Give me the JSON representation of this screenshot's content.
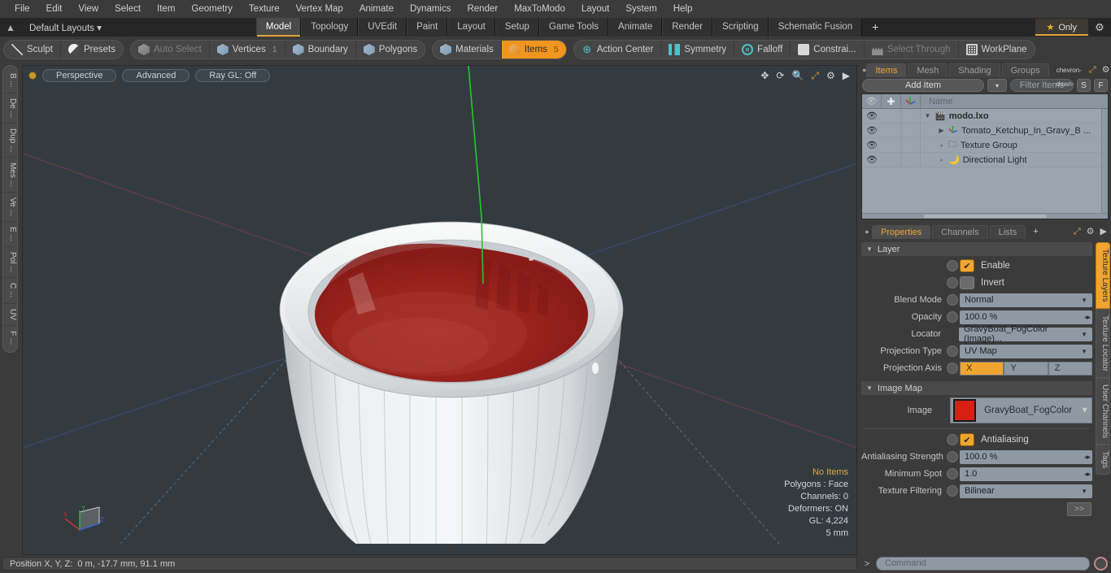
{
  "menu": {
    "items": [
      "File",
      "Edit",
      "View",
      "Select",
      "Item",
      "Geometry",
      "Texture",
      "Vertex Map",
      "Animate",
      "Dynamics",
      "Render",
      "MaxToModo",
      "Layout",
      "System",
      "Help"
    ]
  },
  "layout_row": {
    "home_icon": "home-icon",
    "default_layouts": "Default Layouts",
    "tabs": [
      {
        "label": "Model",
        "active": true
      },
      {
        "label": "Topology",
        "active": false
      },
      {
        "label": "UVEdit",
        "active": false
      },
      {
        "label": "Paint",
        "active": false
      },
      {
        "label": "Layout",
        "active": false
      },
      {
        "label": "Setup",
        "active": false
      },
      {
        "label": "Game Tools",
        "active": false
      },
      {
        "label": "Animate",
        "active": false
      },
      {
        "label": "Render",
        "active": false
      },
      {
        "label": "Scripting",
        "active": false
      },
      {
        "label": "Schematic Fusion",
        "active": false
      }
    ],
    "add_tab": "+",
    "only_label": "Only",
    "star_icon": "star-icon",
    "gear_icon": "gear-icon"
  },
  "toolbar": {
    "group1": [
      {
        "label": "Sculpt",
        "icon": "pen-icon",
        "state": "normal",
        "count": ""
      },
      {
        "label": "Presets",
        "icon": "sphere-icon",
        "state": "normal",
        "count": ""
      }
    ],
    "group2": [
      {
        "label": "Auto Select",
        "icon": "cube-grey-icon",
        "state": "dim",
        "count": ""
      },
      {
        "label": "Vertices",
        "icon": "cube-icon",
        "state": "normal",
        "count": "1"
      },
      {
        "label": "Boundary",
        "icon": "cube-icon",
        "state": "normal",
        "count": ""
      },
      {
        "label": "Polygons",
        "icon": "cube-icon",
        "state": "normal",
        "count": ""
      }
    ],
    "group3": [
      {
        "label": "Materials",
        "icon": "cube-icon",
        "state": "normal",
        "count": ""
      },
      {
        "label": "Items",
        "icon": "cube-orange-icon",
        "state": "selected",
        "count": "5"
      }
    ],
    "group4": [
      {
        "label": "Action Center",
        "icon": "crosshair-icon",
        "state": "normal",
        "count": ""
      },
      {
        "label": "Symmetry",
        "icon": "bars-icon",
        "state": "normal",
        "count": ""
      },
      {
        "label": "Falloff",
        "icon": "ring-icon",
        "state": "normal",
        "count": ""
      },
      {
        "label": "Constrai...",
        "icon": "square-icon",
        "state": "normal",
        "count": ""
      },
      {
        "label": "Select Through",
        "icon": "people-icon",
        "state": "dim",
        "count": ""
      },
      {
        "label": "WorkPlane",
        "icon": "grid-icon",
        "state": "normal",
        "count": ""
      }
    ]
  },
  "left_tabs": [
    "B ...",
    "De ...",
    "Dup ...",
    "Mes ...",
    "Ve ...",
    "E ...",
    "Pol ...",
    "C ...",
    "UV",
    "F ..."
  ],
  "viewport": {
    "mode_button": "Perspective",
    "shading_button": "Advanced",
    "raygl_button": "Ray GL: Off",
    "icons": [
      "move-icon",
      "rotate-icon",
      "zoom-icon",
      "fit-icon",
      "gear-icon",
      "play-icon"
    ],
    "stats": {
      "selection": "No Items",
      "polygons": "Polygons : Face",
      "channels": "Channels: 0",
      "deformers": "Deformers: ON",
      "gl": "GL: 4,224",
      "scale": "5 mm"
    },
    "gizmo_axes": [
      "X",
      "Y",
      "Z"
    ],
    "background_color": "#333b41",
    "model_colors": {
      "bowl": "#e8eaec",
      "sauce": "#9b1f1b",
      "sauce_dark": "#7d1714"
    }
  },
  "status_bar": {
    "position_label": "Position X, Y, Z:",
    "position_value": "0 m, -17.7 mm, 91.1 mm"
  },
  "items_panel": {
    "tabs": [
      {
        "label": "Items",
        "active": true
      },
      {
        "label": "Mesh ...",
        "active": false
      },
      {
        "label": "Shading",
        "active": false
      },
      {
        "label": "Groups",
        "active": false
      }
    ],
    "tab_menu_icon": "chevron-down-icon",
    "expand_icon": "expand-icon",
    "gear_icon": "gear-icon",
    "more_icon": "play-icon",
    "add_item": "Add Item",
    "add_item_dropdown": "chevron-down-icon",
    "filter_placeholder": "Filter Items",
    "s_button": "S",
    "f_button": "F",
    "columns": [
      "eye-icon",
      "move-icon",
      "axis-icon",
      "Name"
    ],
    "rows": [
      {
        "name": "modo.lxo",
        "icon": "scene-icon",
        "depth": 0,
        "bold": true,
        "twisty": "down"
      },
      {
        "name": "Tomato_Ketchup_In_Gravy_B ...",
        "icon": "axis-icon",
        "depth": 1,
        "bold": false,
        "twisty": "right"
      },
      {
        "name": "Texture Group",
        "icon": "folder-icon",
        "depth": 1,
        "bold": false,
        "twisty": "none"
      },
      {
        "name": "Directional Light",
        "icon": "light-icon",
        "depth": 1,
        "bold": false,
        "twisty": "none"
      }
    ]
  },
  "properties_panel": {
    "tabs": [
      {
        "label": "Properties",
        "active": true
      },
      {
        "label": "Channels",
        "active": false
      },
      {
        "label": "Lists",
        "active": false
      }
    ],
    "add_tab": "+",
    "expand_icon": "expand-icon",
    "gear_icon": "gear-icon",
    "more_icon": "play-icon",
    "sections": [
      {
        "title": "Layer"
      },
      {
        "title": "Image Map"
      }
    ],
    "layer": {
      "enable_label": "Enable",
      "enable_checked": true,
      "invert_label": "Invert",
      "invert_checked": false,
      "blend_mode_label": "Blend Mode",
      "blend_mode_value": "Normal",
      "opacity_label": "Opacity",
      "opacity_value": "100.0 %",
      "locator_label": "Locator",
      "locator_value": "GravyBoat_FogColor (Image)...",
      "projection_type_label": "Projection Type",
      "projection_type_value": "UV Map",
      "projection_axis_label": "Projection Axis",
      "projection_axis_options": [
        "X",
        "Y",
        "Z"
      ],
      "projection_axis_selected": "X"
    },
    "image_map": {
      "image_label": "Image",
      "image_name": "GravyBoat_FogColor",
      "image_swatch_color": "#d81f14",
      "antialiasing_label": "Antialiasing",
      "antialiasing_checked": true,
      "aa_strength_label": "Antialiasing Strength",
      "aa_strength_value": "100.0 %",
      "min_spot_label": "Minimum Spot",
      "min_spot_value": "1.0",
      "texture_filtering_label": "Texture Filtering",
      "texture_filtering_value": "Bilinear",
      "more_button": ">>"
    }
  },
  "right_vtabs": [
    {
      "label": "Texture Layers",
      "active": true
    },
    {
      "label": "Texture Locator",
      "active": false
    },
    {
      "label": "User Channels",
      "active": false
    },
    {
      "label": "Tags",
      "active": false
    }
  ],
  "command_bar": {
    "prompt": "&gt;",
    "placeholder": "Command",
    "record_icon": "record-icon"
  }
}
